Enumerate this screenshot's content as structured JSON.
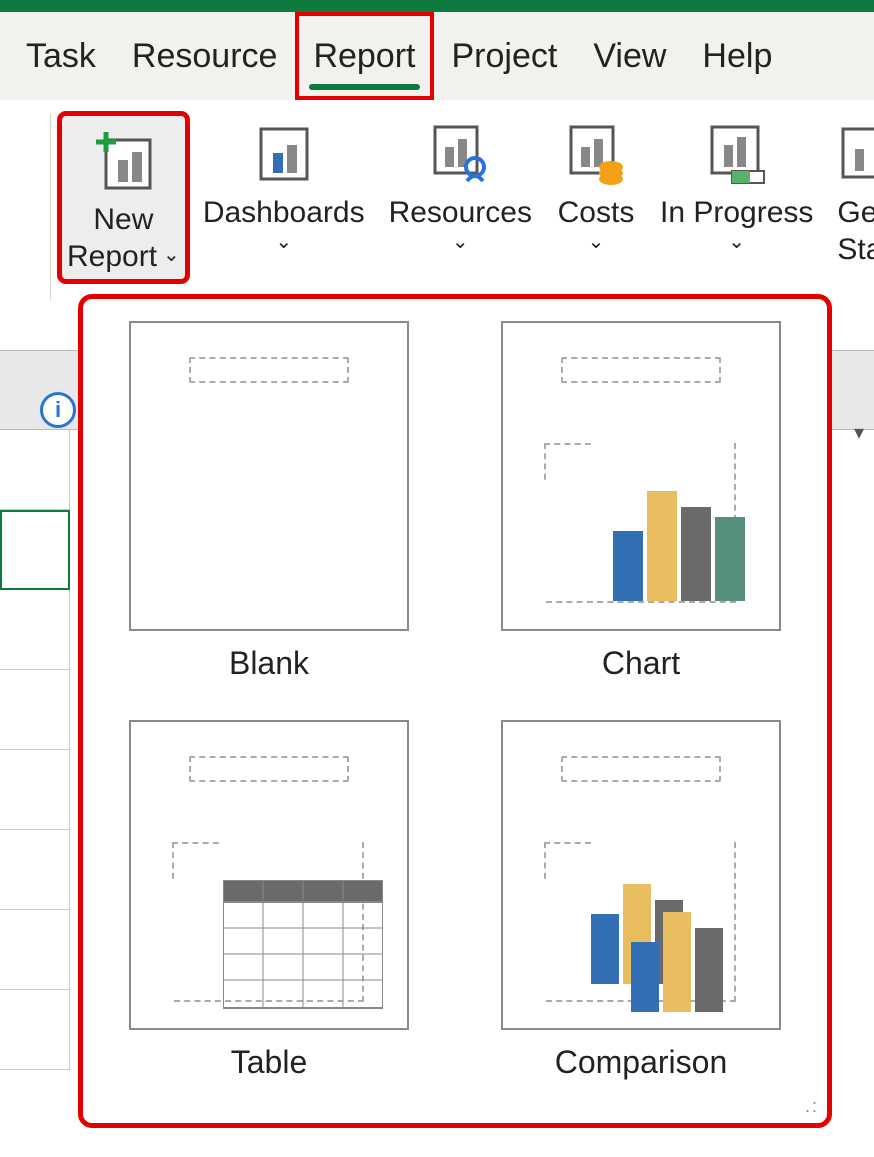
{
  "tabs": {
    "task": "Task",
    "resource": "Resource",
    "report": "Report",
    "project": "Project",
    "view": "View",
    "help": "Help"
  },
  "ribbon": {
    "new_report_line1": "New",
    "new_report_line2": "Report",
    "dashboards": "Dashboards",
    "resources": "Resources",
    "costs": "Costs",
    "in_progress": "In Progress",
    "getting_started_line1": "Ge",
    "getting_started_line2": "Star"
  },
  "gallery": {
    "blank": "Blank",
    "chart": "Chart",
    "table": "Table",
    "comparison": "Comparison"
  },
  "info_letter": "i"
}
